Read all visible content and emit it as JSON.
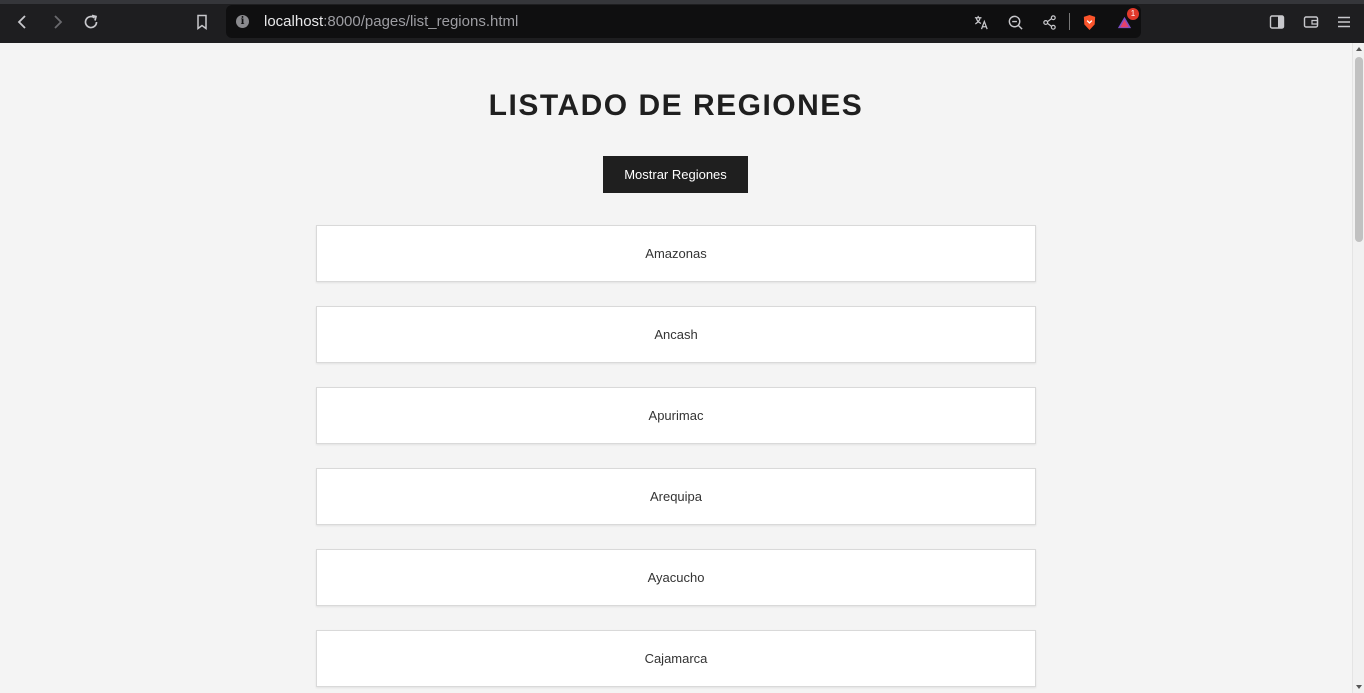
{
  "browser": {
    "url_host": "localhost",
    "url_rest": ":8000/pages/list_regions.html",
    "notification_count": "1",
    "icons": {
      "back": "back-arrow-icon",
      "forward": "forward-arrow-icon",
      "reload": "reload-icon",
      "bookmark": "bookmark-icon",
      "site_info": "info-icon",
      "translate": "translate-icon",
      "zoom_out": "zoom-out-icon",
      "share": "share-icon",
      "brave": "brave-shield-icon",
      "rewards": "rewards-triangle-icon",
      "sidebar": "sidebar-icon",
      "wallet": "wallet-icon",
      "menu": "menu-icon"
    }
  },
  "page": {
    "title": "LISTADO DE REGIONES",
    "button_label": "Mostrar Regiones",
    "regions": [
      "Amazonas",
      "Ancash",
      "Apurimac",
      "Arequipa",
      "Ayacucho",
      "Cajamarca"
    ]
  },
  "colors": {
    "page_bg": "#f4f4f4",
    "button_bg": "#1f1f1f",
    "card_bg": "#ffffff",
    "chrome_bg": "#1e1e20"
  }
}
